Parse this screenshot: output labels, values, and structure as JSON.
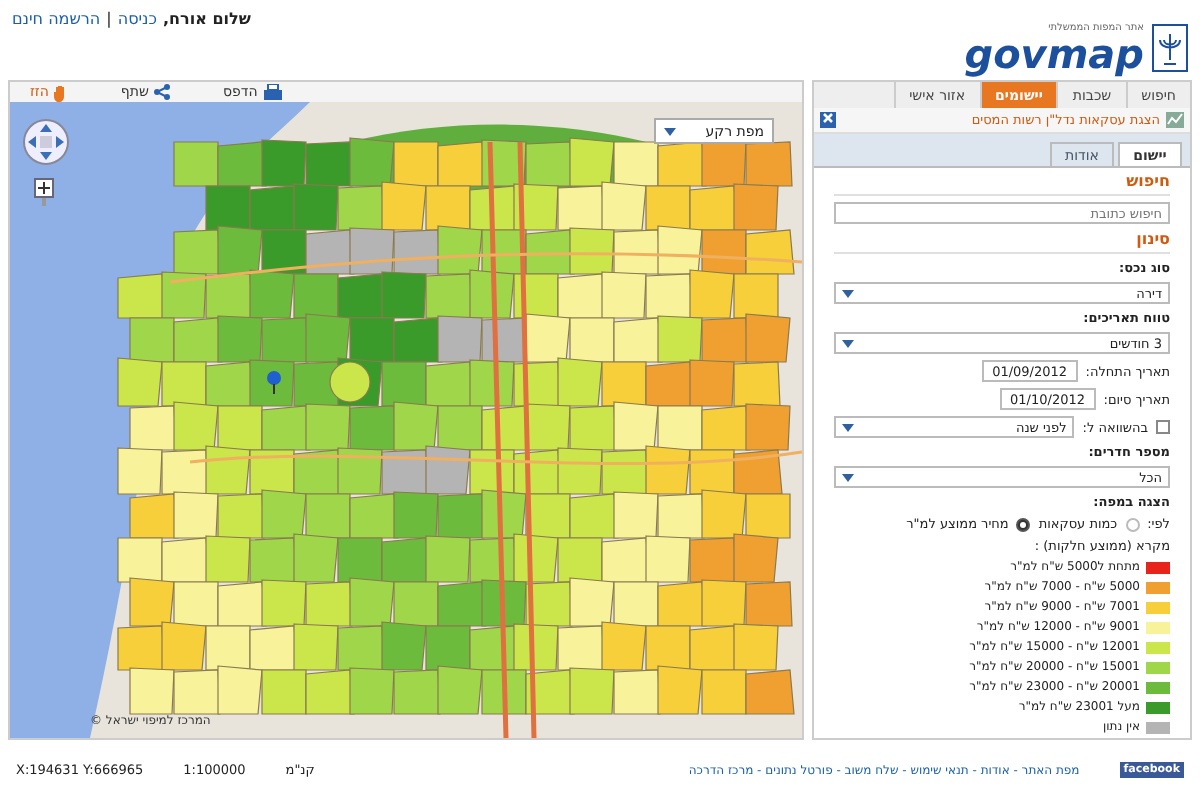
{
  "header": {
    "greeting": "שלום אורח,",
    "login": "כניסה",
    "separator": "|",
    "register": "הרשמה חינם",
    "logo": "govmap",
    "logo_subtitle": "אתר המפות הממשלתי"
  },
  "map_toolbar": [
    {
      "kind": "print",
      "label": "הדפס"
    },
    {
      "kind": "share",
      "label": "שתף"
    },
    {
      "kind": "pan",
      "label": "הזז"
    }
  ],
  "map": {
    "base_layer": "מפת רקע",
    "copyright": "© המרכז למיפוי ישראל"
  },
  "side_tabs": [
    {
      "label": "חיפוש",
      "selected": false
    },
    {
      "label": "שכבות",
      "selected": false
    },
    {
      "label": "יישומים",
      "selected": true
    },
    {
      "label": "אזור אישי",
      "selected": false
    }
  ],
  "panel": {
    "title": "הצגת עסקאות נדל\"ן רשות המסים",
    "sub_tabs": [
      {
        "label": "יישום",
        "selected": true
      },
      {
        "label": "אודות",
        "selected": false
      }
    ],
    "search_heading": "חיפוש",
    "search_placeholder": "חיפוש כתובת",
    "filter_heading": "סינון",
    "property_type": {
      "label": "סוג נכס:",
      "value": "דירה"
    },
    "date_range": {
      "label": "טווח תאריכים:",
      "value": "3 חודשים"
    },
    "start_date": {
      "label": "תאריך התחלה:",
      "value": "01/09/2012"
    },
    "end_date": {
      "label": "תאריך סיום:",
      "value": "01/10/2012"
    },
    "compare": {
      "label": "בהשוואה ל:",
      "checked": false,
      "value": "לפני שנה"
    },
    "rooms": {
      "label": "מספר חדרים:",
      "value": "הכל"
    },
    "display_heading": "הצגה במפה:",
    "display_by": "לפי:",
    "display_options": [
      {
        "label": "כמות עסקאות",
        "selected": false
      },
      {
        "label": "מחיר ממוצע למ\"ר",
        "selected": true
      }
    ],
    "legend_title": "מקרא (ממוצע חלקות) :",
    "legend": [
      {
        "label": "מתחת ל5000 ש\"ח למ\"ר",
        "color": "#e8231c"
      },
      {
        "label": "5000 ש\"ח - 7000 ש\"ח למ\"ר",
        "color": "#f0a030"
      },
      {
        "label": "7001 ש\"ח - 9000 ש\"ח למ\"ר",
        "color": "#f7cf3a"
      },
      {
        "label": "9001 ש\"ח - 12000 ש\"ח למ\"ר",
        "color": "#f8f39a"
      },
      {
        "label": "12001 ש\"ח - 15000 ש\"ח למ\"ר",
        "color": "#cbe64a"
      },
      {
        "label": "15001 ש\"ח - 20000 ש\"ח למ\"ר",
        "color": "#9fd64a"
      },
      {
        "label": "20001 ש\"ח - 23000 ש\"ח למ\"ר",
        "color": "#6dbb3c"
      },
      {
        "label": "מעל 23001 ש\"ח למ\"ר",
        "color": "#3a9a2a"
      },
      {
        "label": "אין נתון",
        "color": "#b4b4b4"
      }
    ]
  },
  "status_bar": {
    "coordinates": "X:194631 Y:666965",
    "scale": "1:100000",
    "scale_label": "קנ\"מ",
    "facebook": "facebook",
    "links": "מפת האתר - אודות - תנאי שימוש - שלח משוב - פורטל נתונים - מרכז הדרכה"
  }
}
